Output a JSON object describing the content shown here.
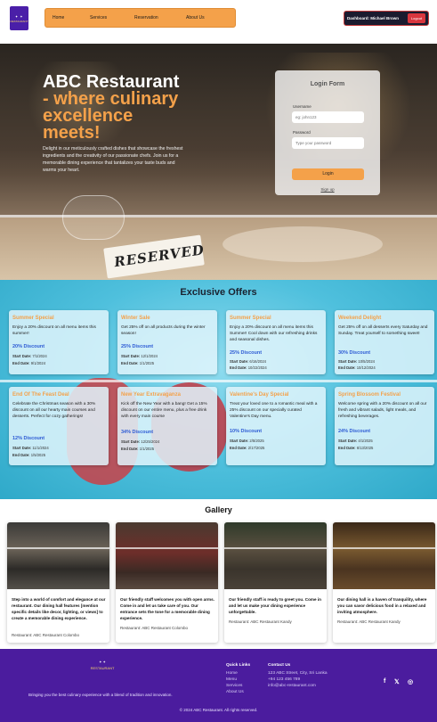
{
  "header": {
    "logo_top": "✦ ✦",
    "logo_bottom": "RESTAURANT",
    "nav": [
      "Home",
      "Services",
      "Reservation",
      "About Us"
    ],
    "dashboard": "Dashboard: Michael Brown",
    "logout": "Logout"
  },
  "hero": {
    "title_line1": "ABC Restaurant",
    "title_line2": "- where culinary excellence meets!",
    "description": "Delight in our meticulously crafted dishes that showcase the freshest ingredients and the creativity of our passionate chefs. Join us for a memorable dining experience that tantalizes your taste buds and warms your heart.",
    "reserved_sign": "RESERVED"
  },
  "login": {
    "title": "Login Form",
    "username_label": "Username",
    "username_placeholder": "eg: john123",
    "password_label": "Password",
    "password_placeholder": "Type your password",
    "button": "Login",
    "signup": "Sign up"
  },
  "offers": {
    "title": "Exclusive Offers",
    "start_label": "Start Date:",
    "end_label": "End Date:",
    "cards": [
      {
        "title": "Summer Special",
        "desc": "Enjoy a 20% discount on all menu items this summer!",
        "discount": "20% Discount",
        "start": "7/1/2024",
        "end": "9/1/2024"
      },
      {
        "title": "Winter Sale",
        "desc": "Get 25% off on all products during the winter season!",
        "discount": "25% Discount",
        "start": "12/1/2024",
        "end": "1/1/2025"
      },
      {
        "title": "Summer Special",
        "desc": "Enjoy a 20% discount on all menu items this Summer! Cool down with our refreshing drinks and seasonal dishes.",
        "discount": "25% Discount",
        "start": "6/16/2024",
        "end": "10/22/2024"
      },
      {
        "title": "Weekend Delight",
        "desc": "Get 25% off on all desserts every Saturday and Sunday. Treat yourself to something sweet!",
        "discount": "30% Discount",
        "start": "10/5/2024",
        "end": "10/12/2024"
      },
      {
        "title": "End Of The Feast Deal",
        "desc": "Celebrate the Christmas season with a 30% discount on all our hearty main courses and desserts. Perfect for cozy gatherings!",
        "discount": "12% Discount",
        "start": "11/1/2024",
        "end": "1/5/2025"
      },
      {
        "title": "New Year Extravaganza",
        "desc": "Kick off the New Year with a bang! Get a 15% discount on our entire menu, plus a free drink with every main course",
        "discount": "34% Discount",
        "start": "12/25/2024",
        "end": "1/1/2025"
      },
      {
        "title": "Valentine's Day Special",
        "desc": "Treat your loved one to a romantic meal with a 25% discount on our specially curated Valentine's Day menu.",
        "discount": "10% Discount",
        "start": "2/5/2025",
        "end": "2/17/2025"
      },
      {
        "title": "Spring Blossom Festival",
        "desc": "Welcome spring with a 20% discount on all our fresh and vibrant salads, light meals, and refreshing beverages.",
        "discount": "24% Discount",
        "start": "4/1/2025",
        "end": "6/13/2025"
      }
    ]
  },
  "gallery": {
    "title": "Gallery",
    "restaurant_label": "Restaurant:",
    "cards": [
      {
        "desc": "Step into a world of comfort and elegance at our restaurant. Our dining hall features [mention specific details like decor, lighting, or views] to create a memorable dining experience.",
        "restaurant": "ABC Restaurant Colombo"
      },
      {
        "desc": "Our friendly staff welcomes you with open arms. Come in and let us take care of you. Our entrance sets the tone for a memorable dining experience.",
        "restaurant": "ABC Restaurant Colombo"
      },
      {
        "desc": "Our friendly staff is ready to greet you. Come in and let us make your dining experience unforgettable.",
        "restaurant": "ABC Restaurant Kandy"
      },
      {
        "desc": "Our dining hall is a haven of tranquility, where you can savor delicious food in a relaxed and inviting atmosphere.",
        "restaurant": "ABC Restaurant Kandy"
      }
    ]
  },
  "footer": {
    "logo_top": "✦ ✦",
    "logo_bottom": "RESTAURANT",
    "tagline": "Bringing you the best culinary experience with a blend of tradition and innovation.",
    "quick_links_title": "Quick Links",
    "quick_links": [
      "Home",
      "Menu",
      "Services",
      "About Us"
    ],
    "contact_title": "Contact Us",
    "contact": [
      "123 ABC Street, City, Sri Lanka",
      "+94 123 456 789",
      "info@abc-restaurant.com"
    ],
    "social": [
      "f",
      "𝕏",
      "◎"
    ],
    "copyright": "© 2024 ABC Restaurant. All rights reserved."
  },
  "colors": {
    "accent": "#f4a14a",
    "footer": "#4b1c9e",
    "link": "#2c5ad4"
  }
}
